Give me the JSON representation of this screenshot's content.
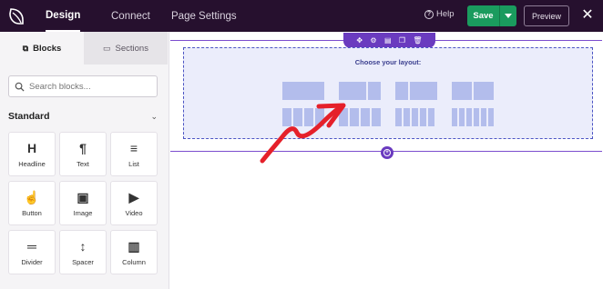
{
  "topbar": {
    "logo_icon": "seedprod-leaf-icon",
    "tabs": [
      {
        "label": "Design",
        "active": true
      },
      {
        "label": "Connect",
        "active": false
      },
      {
        "label": "Page Settings",
        "active": false
      }
    ],
    "help_label": "Help",
    "save_label": "Save",
    "preview_label": "Preview",
    "close_icon": "close-icon"
  },
  "sidebar": {
    "tabs": [
      {
        "label": "Blocks",
        "icon": "blocks-icon",
        "active": true
      },
      {
        "label": "Sections",
        "icon": "sections-icon",
        "active": false
      }
    ],
    "search_placeholder": "Search blocks...",
    "section_title": "Standard",
    "blocks": [
      {
        "label": "Headline",
        "icon": "H"
      },
      {
        "label": "Text",
        "icon": "¶"
      },
      {
        "label": "List",
        "icon": "≡"
      },
      {
        "label": "Button",
        "icon": "☝"
      },
      {
        "label": "Image",
        "icon": "▣"
      },
      {
        "label": "Video",
        "icon": "▶"
      },
      {
        "label": "Divider",
        "icon": "═"
      },
      {
        "label": "Spacer",
        "icon": "↕"
      },
      {
        "label": "Column",
        "icon": "▥"
      }
    ]
  },
  "canvas": {
    "choose_layout_label": "Choose your layout:",
    "layouts": [
      {
        "columns": 1
      },
      {
        "columns": 2
      },
      {
        "columns": 2
      },
      {
        "columns": 2
      },
      {
        "columns": 4
      },
      {
        "columns": 4
      },
      {
        "columns": 5
      },
      {
        "columns": 6
      }
    ],
    "section_toolbar_icons": [
      "move-icon",
      "settings-icon",
      "save-icon",
      "duplicate-icon",
      "delete-icon"
    ],
    "add_section_icon": "add-circle-icon"
  },
  "colors": {
    "topbar_bg": "#26102e",
    "save_green": "#1a9b5e",
    "accent_purple": "#6a3bbf",
    "row_dashed_border": "#4c55c4",
    "layout_fill": "#b3bdec",
    "arrow_red": "#e5202a"
  }
}
